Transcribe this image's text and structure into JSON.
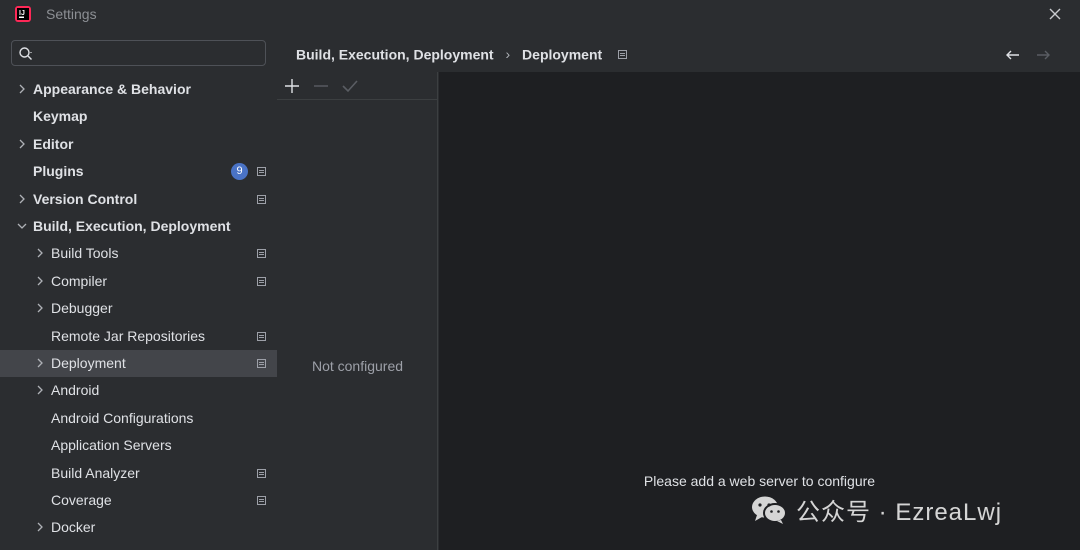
{
  "window": {
    "title": "Settings"
  },
  "search": {
    "placeholder": "",
    "value": ""
  },
  "tree": {
    "items": [
      {
        "label": "Appearance & Behavior",
        "bold": true,
        "expandable": true,
        "expanded": false,
        "level": 0
      },
      {
        "label": "Keymap",
        "bold": true,
        "expandable": false,
        "level": 0
      },
      {
        "label": "Editor",
        "bold": true,
        "expandable": true,
        "expanded": false,
        "level": 0
      },
      {
        "label": "Plugins",
        "bold": true,
        "expandable": false,
        "level": 0,
        "badge": "9",
        "project_icon": true
      },
      {
        "label": "Version Control",
        "bold": true,
        "expandable": true,
        "expanded": false,
        "level": 0,
        "project_icon": true
      },
      {
        "label": "Build, Execution, Deployment",
        "bold": true,
        "expandable": true,
        "expanded": true,
        "level": 0
      },
      {
        "label": "Build Tools",
        "bold": false,
        "expandable": true,
        "expanded": false,
        "level": 1,
        "project_icon": true
      },
      {
        "label": "Compiler",
        "bold": false,
        "expandable": true,
        "expanded": false,
        "level": 1,
        "project_icon": true
      },
      {
        "label": "Debugger",
        "bold": false,
        "expandable": true,
        "expanded": false,
        "level": 1
      },
      {
        "label": "Remote Jar Repositories",
        "bold": false,
        "expandable": false,
        "level": 1,
        "project_icon": true
      },
      {
        "label": "Deployment",
        "bold": false,
        "expandable": true,
        "expanded": false,
        "level": 1,
        "project_icon": true,
        "selected": true
      },
      {
        "label": "Android",
        "bold": false,
        "expandable": true,
        "expanded": false,
        "level": 1
      },
      {
        "label": "Android Configurations",
        "bold": false,
        "expandable": false,
        "level": 1
      },
      {
        "label": "Application Servers",
        "bold": false,
        "expandable": false,
        "level": 1
      },
      {
        "label": "Build Analyzer",
        "bold": false,
        "expandable": false,
        "level": 1,
        "project_icon": true
      },
      {
        "label": "Coverage",
        "bold": false,
        "expandable": false,
        "level": 1,
        "project_icon": true
      },
      {
        "label": "Docker",
        "bold": false,
        "expandable": true,
        "expanded": false,
        "level": 1
      }
    ]
  },
  "breadcrumb": {
    "parent": "Build, Execution, Deployment",
    "separator": "›",
    "current": "Deployment"
  },
  "server_list": {
    "empty_text": "Not configured"
  },
  "detail": {
    "hint": "Please add a web server to configure"
  },
  "watermark": {
    "text": "公众号 · EzreaLwj"
  },
  "colors": {
    "background": "#2b2d30",
    "detail_bg": "#1e1f22",
    "selected": "#43454a",
    "badge": "#4a73c6",
    "text": "#dfe1e5",
    "muted": "#9da0a8"
  },
  "icons": {
    "app": "intellij-logo-icon",
    "close": "close-icon",
    "search": "search-icon",
    "add": "plus-icon",
    "remove": "minus-icon",
    "apply": "check-icon",
    "back": "arrow-left-icon",
    "forward": "arrow-right-icon",
    "chevron_right": "chevron-right-icon",
    "chevron_down": "chevron-down-icon",
    "project_scope": "project-scope-icon",
    "watermark": "wechat-icon"
  }
}
